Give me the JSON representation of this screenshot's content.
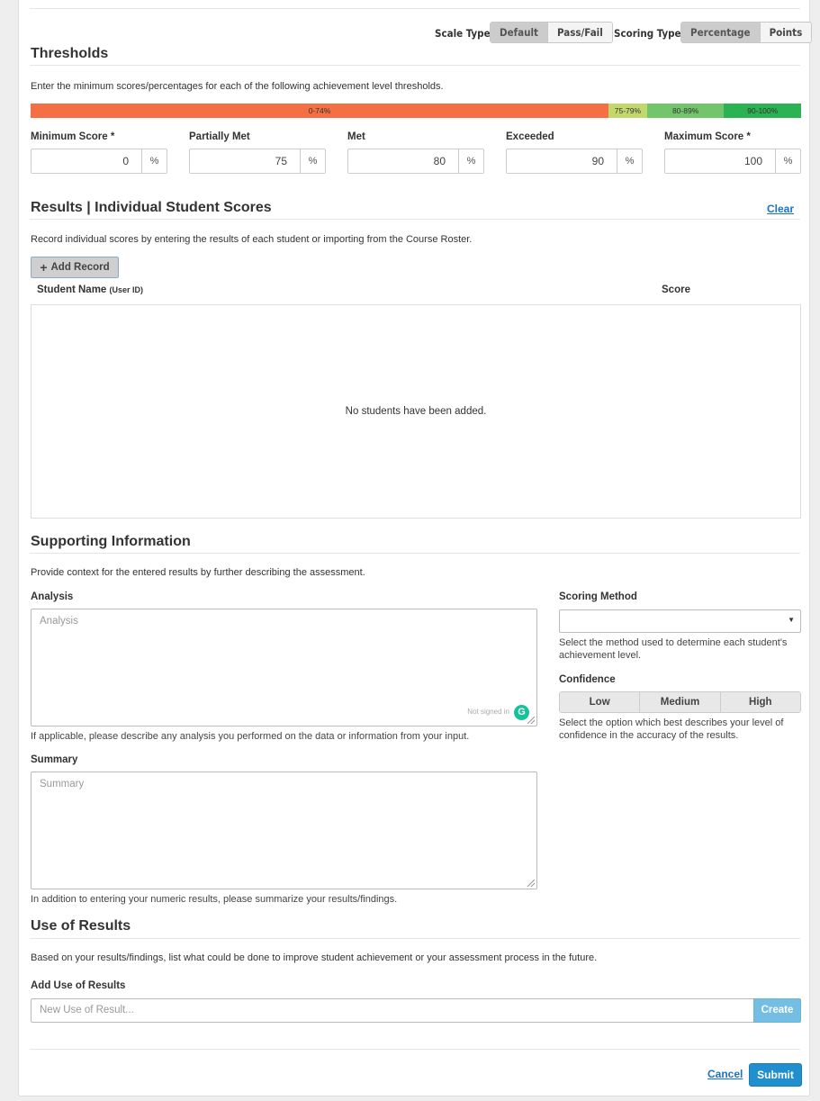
{
  "header": {
    "scale_type_label": "Scale Type",
    "scale_type_options": [
      "Default",
      "Pass/Fail"
    ],
    "scoring_type_label": "Scoring Type",
    "scoring_type_options": [
      "Percentage",
      "Points"
    ]
  },
  "thresholds": {
    "title": "Thresholds",
    "description": "Enter the minimum scores/percentages for each of the following achievement level thresholds.",
    "bar": [
      {
        "label": "0-74%",
        "color": "#f47044",
        "fraction": 0.75
      },
      {
        "label": "75-79%",
        "color": "#c3d86c",
        "fraction": 0.05
      },
      {
        "label": "80-89%",
        "color": "#73c56c",
        "fraction": 0.1
      },
      {
        "label": "90-100%",
        "color": "#2bb253",
        "fraction": 0.1
      }
    ],
    "fields": [
      {
        "label": "Minimum Score *",
        "value": "0",
        "unit": "%"
      },
      {
        "label": "Partially Met",
        "value": "75",
        "unit": "%"
      },
      {
        "label": "Met",
        "value": "80",
        "unit": "%"
      },
      {
        "label": "Exceeded",
        "value": "90",
        "unit": "%"
      },
      {
        "label": "Maximum Score *",
        "value": "100",
        "unit": "%"
      }
    ]
  },
  "results": {
    "title": "Results | Individual Student Scores",
    "clear_label": "Clear",
    "description": "Record individual scores by entering the results of each student or importing from the Course Roster.",
    "add_record_label": "Add Record",
    "col_student": "Student Name",
    "col_student_sub": "(User ID)",
    "col_score": "Score",
    "empty_message": "No students have been added."
  },
  "supporting": {
    "title": "Supporting Information",
    "description": "Provide context for the entered results by further describing the assessment.",
    "analysis_label": "Analysis",
    "analysis_placeholder": "Analysis",
    "analysis_status": "Not signed in",
    "analysis_help": "If applicable, please describe any analysis you performed on the data or information from your input.",
    "summary_label": "Summary",
    "summary_placeholder": "Summary",
    "summary_help": "In addition to entering your numeric results, please summarize your results/findings.",
    "scoring_method_label": "Scoring Method",
    "scoring_method_value": "",
    "scoring_method_help": "Select the method used to determine each student's achievement level.",
    "confidence_label": "Confidence",
    "confidence_options": [
      "Low",
      "Medium",
      "High"
    ],
    "confidence_help": "Select the option which best describes your level of confidence in the accuracy of the results."
  },
  "use_of_results": {
    "title": "Use of Results",
    "description": "Based on your results/findings, list what could be done to improve student achievement or your assessment process in the future.",
    "add_label": "Add Use of Results",
    "placeholder": "New Use of Result...",
    "create_label": "Create"
  },
  "footer": {
    "cancel_label": "Cancel",
    "submit_label": "Submit"
  }
}
